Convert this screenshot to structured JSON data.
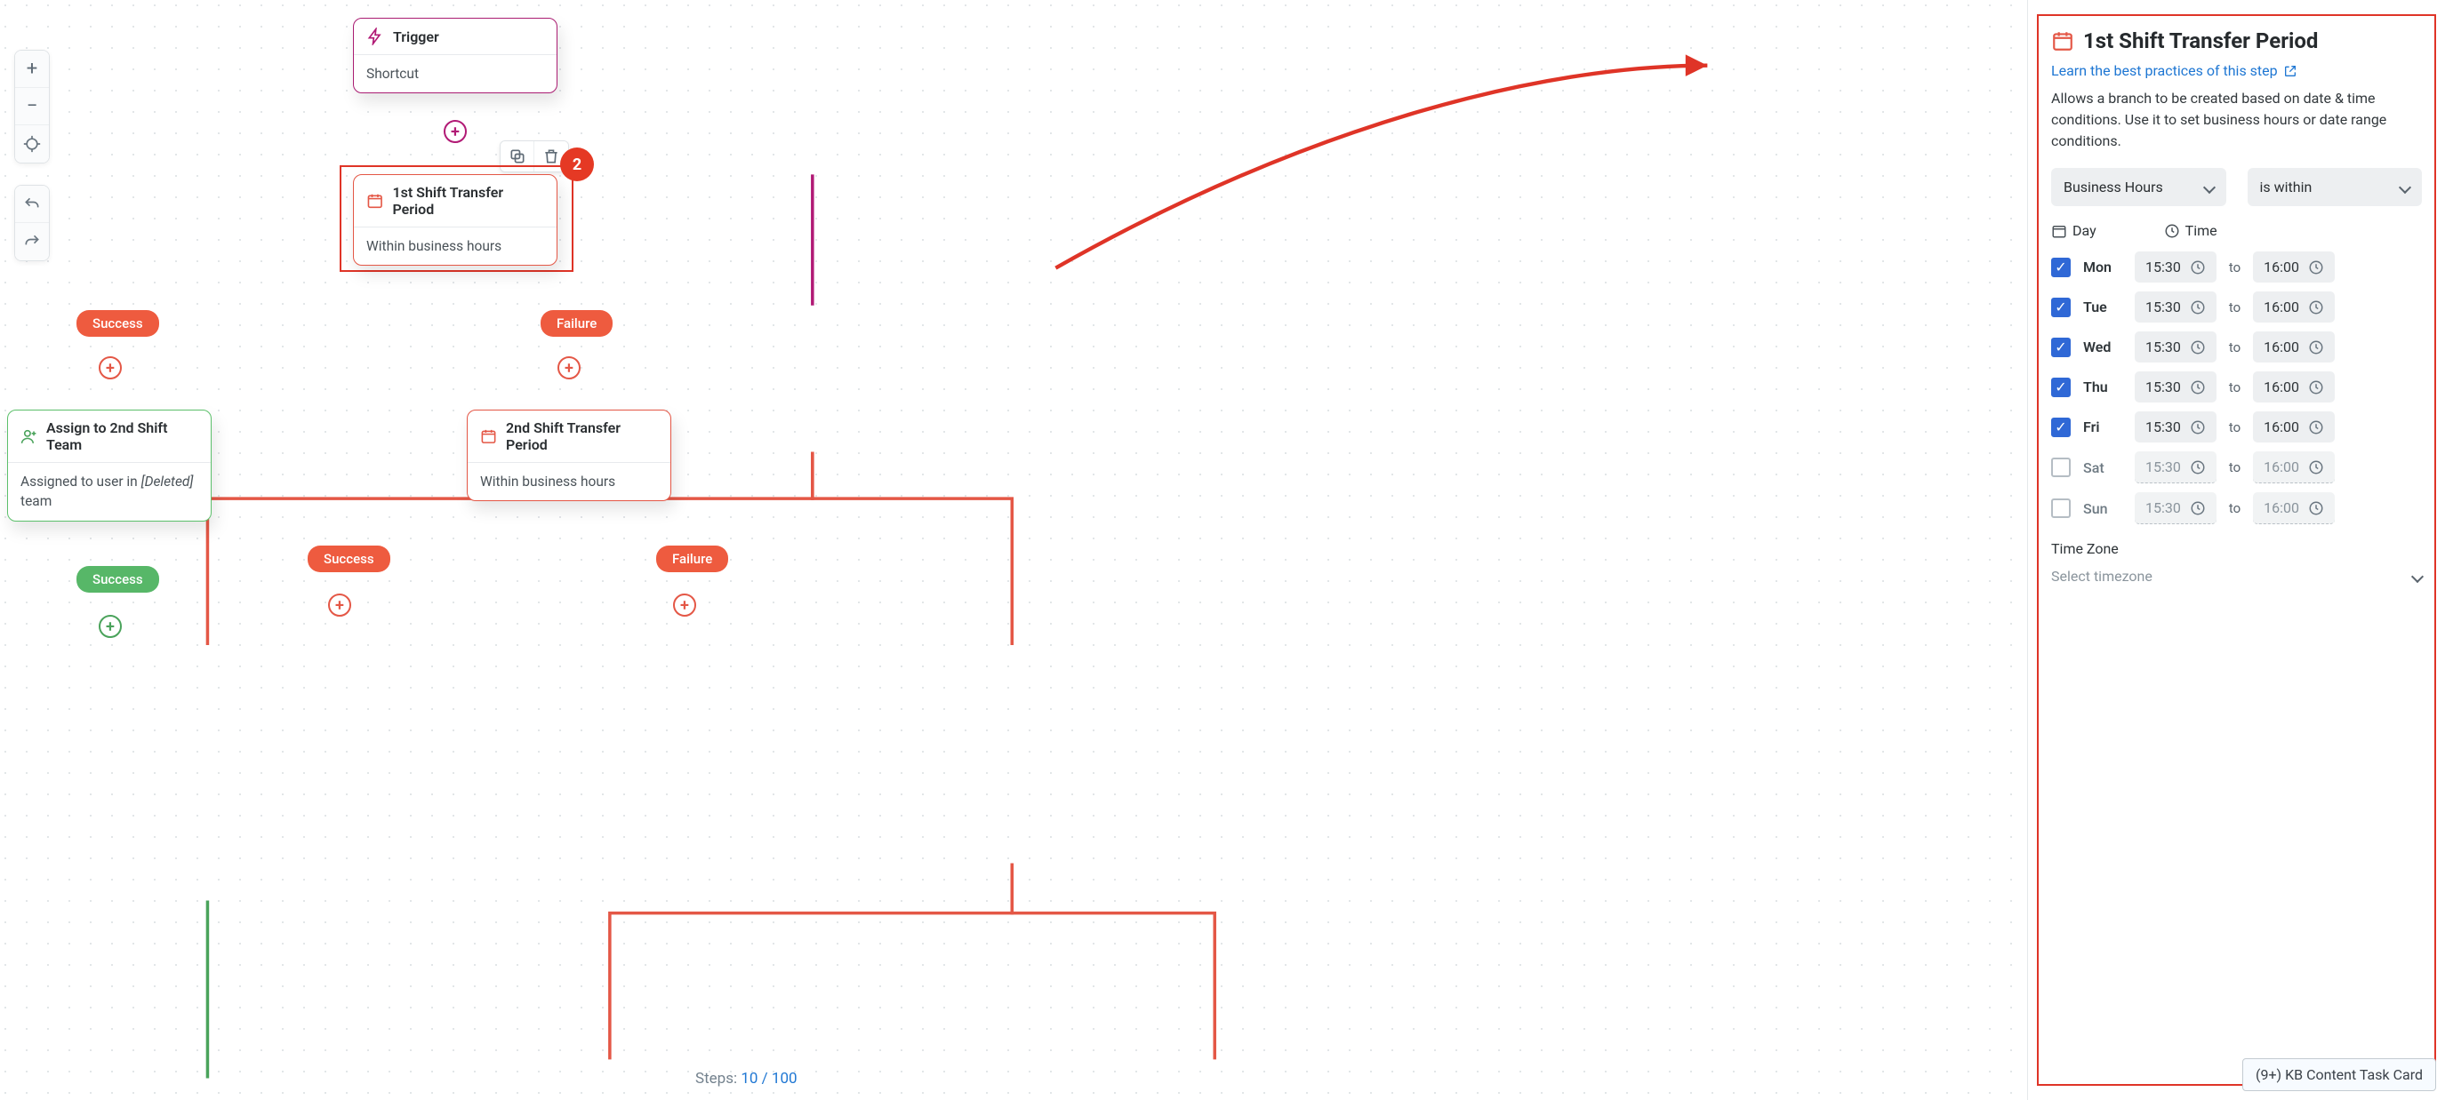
{
  "canvas": {
    "nodes": {
      "trigger": {
        "title": "Trigger",
        "body": "Shortcut"
      },
      "period1": {
        "title": "1st Shift Transfer Period",
        "body": "Within business hours"
      },
      "assign": {
        "title": "Assign to 2nd Shift Team",
        "body_pre": "Assigned to user in ",
        "body_em": "[Deleted]",
        "body_post": " team"
      },
      "period2": {
        "title": "2nd Shift Transfer Period",
        "body": "Within business hours"
      }
    },
    "pills": {
      "p1_success": "Success",
      "p1_failure": "Failure",
      "assign_success": "Success",
      "p2_success": "Success",
      "p2_failure": "Failure"
    },
    "steps_label": "Steps: ",
    "steps_used": "10",
    "steps_sep": " / ",
    "steps_max": "100",
    "annotation_badge": "2"
  },
  "inspector": {
    "title": "1st Shift Transfer Period",
    "learn_link": "Learn the best practices of this step",
    "description": "Allows a branch to be created based on date & time conditions. Use it to set business hours or date range conditions.",
    "select_condition_type": "Business Hours",
    "select_operator": "is within",
    "day_header": "Day",
    "time_header": "Time",
    "to_label": "to",
    "days": {
      "mon": {
        "name": "Mon",
        "on": true,
        "from": "15:30",
        "to": "16:00"
      },
      "tue": {
        "name": "Tue",
        "on": true,
        "from": "15:30",
        "to": "16:00"
      },
      "wed": {
        "name": "Wed",
        "on": true,
        "from": "15:30",
        "to": "16:00"
      },
      "thu": {
        "name": "Thu",
        "on": true,
        "from": "15:30",
        "to": "16:00"
      },
      "fri": {
        "name": "Fri",
        "on": true,
        "from": "15:30",
        "to": "16:00"
      },
      "sat": {
        "name": "Sat",
        "on": false,
        "from": "15:30",
        "to": "16:00"
      },
      "sun": {
        "name": "Sun",
        "on": false,
        "from": "15:30",
        "to": "16:00"
      }
    },
    "timezone_label": "Time Zone",
    "timezone_placeholder": "Select timezone"
  },
  "footer": {
    "kb_card": "(9+) KB Content Task Card"
  }
}
